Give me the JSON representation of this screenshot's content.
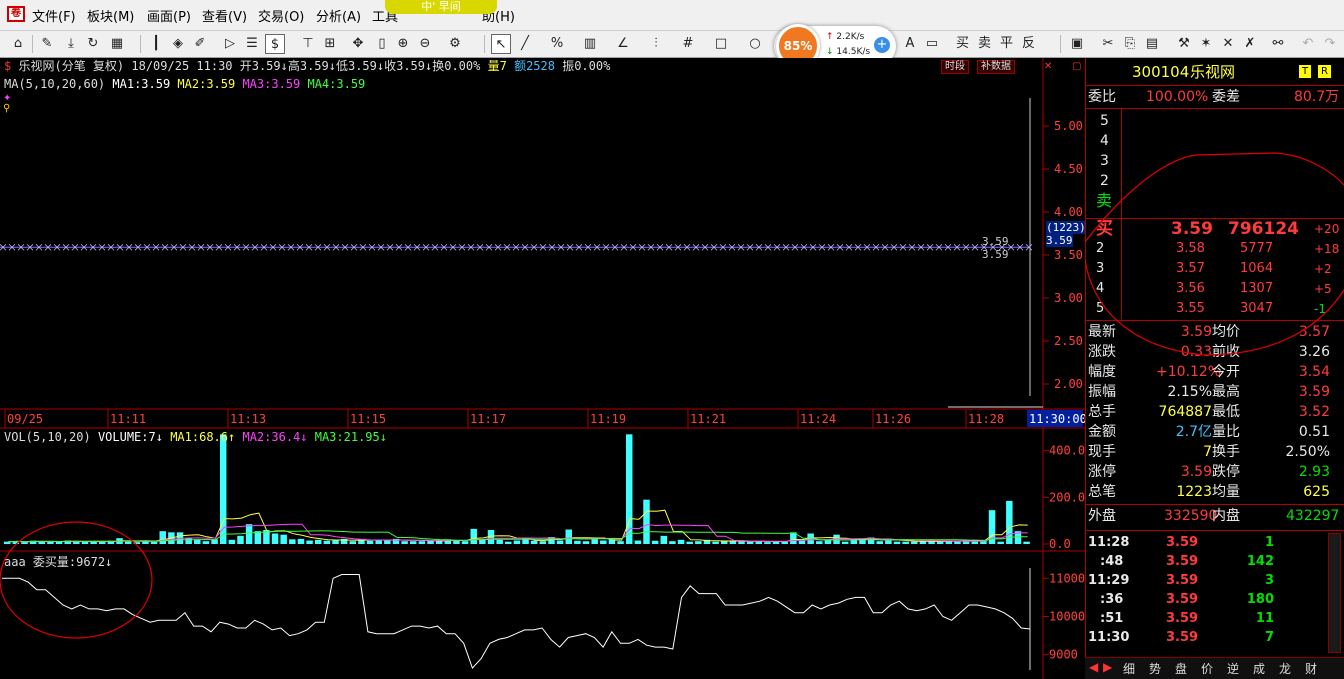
{
  "menu": {
    "items": [
      "文件(F)",
      "板块(M)",
      "画面(P)",
      "查看(V)",
      "交易(O)",
      "分析(A)",
      "工具",
      "助(H)"
    ],
    "balloon": "中' 早间"
  },
  "speed": {
    "percent": "85%",
    "up": "2.2K/s",
    "down": "14.5K/s"
  },
  "toolbar": {
    "tx": [
      "买",
      "卖",
      "平",
      "反"
    ]
  },
  "chart": {
    "header": "乐视网(分笔 复权) 18/09/25 11:30 开3.59↓高3.59↓低3.59↓收3.59↓换0.00%",
    "header_vol": "量7",
    "header_amt": "额2528",
    "header_amp": "振0.00%",
    "ma_label": "MA(5,10,20,60)",
    "ma1": "MA1:3.59",
    "ma2": "MA2:3.59",
    "ma3": "MA3:3.59",
    "ma4": "MA4:3.59",
    "btn_time": "时段",
    "btn_fill": "补数据",
    "price_labels": [
      "5.00",
      "4.50",
      "4.00",
      "3.50",
      "3.00",
      "2.50",
      "2.00"
    ],
    "price_tag_1": "(1223)",
    "price_tag_2": "3.59",
    "price_line_lbl": "3.59",
    "time_labels": [
      "09/25",
      "11:11",
      "11:13",
      "11:15",
      "11:17",
      "11:19",
      "11:21",
      "11:24",
      "11:26",
      "11:28"
    ],
    "time_current": "11:30:00",
    "vol_label": "VOL(5,10,20)",
    "vol_value": "VOLUME:7↓",
    "vol_ma1": "MA1:68.6↑",
    "vol_ma2": "MA2:36.4↓",
    "vol_ma3": "MA3:21.95↓",
    "vol_axis": [
      "400.0",
      "200.0",
      "0.0"
    ],
    "ind_label": "aaa",
    "ind_value": "委买量:9672↓",
    "ind_axis": [
      "11000",
      "10000",
      "9000"
    ]
  },
  "chart_data": [
    {
      "type": "bar",
      "title": "VOL(5,10,20)",
      "ylim": [
        0,
        480
      ],
      "values": [
        10,
        12,
        8,
        14,
        12,
        10,
        9,
        15,
        11,
        10,
        12,
        9,
        14,
        25,
        10,
        8,
        12,
        10,
        55,
        50,
        50,
        25,
        18,
        12,
        20,
        470,
        18,
        35,
        85,
        55,
        60,
        45,
        40,
        20,
        22,
        15,
        18,
        14,
        16,
        22,
        12,
        20,
        14,
        18,
        16,
        22,
        12,
        12,
        12,
        14,
        14,
        20,
        14,
        12,
        65,
        20,
        60,
        18,
        10,
        15,
        25,
        14,
        12,
        30,
        15,
        62,
        14,
        12,
        25,
        15,
        20,
        12,
        470,
        15,
        190,
        14,
        35,
        12,
        18,
        10,
        12,
        18,
        10,
        14,
        12,
        10,
        10,
        14,
        8,
        12,
        10,
        50,
        14,
        45,
        12,
        18,
        40,
        10,
        18,
        20,
        28,
        12,
        15,
        10,
        10,
        10,
        12,
        14,
        10,
        12,
        12,
        18,
        12,
        15,
        145,
        10,
        185,
        55,
        10
      ]
    },
    {
      "type": "line",
      "title": "委买量",
      "ylim": [
        8600,
        11400
      ],
      "values": [
        11000,
        11000,
        11000,
        10900,
        10700,
        10700,
        10500,
        10300,
        10200,
        10300,
        10200,
        10200,
        10150,
        10200,
        10200,
        10050,
        9950,
        9850,
        9900,
        9900,
        9900,
        10100,
        9750,
        9750,
        9600,
        9850,
        9800,
        9700,
        9700,
        9900,
        9800,
        9650,
        9700,
        9500,
        9550,
        9650,
        9850,
        9850,
        11000,
        11100,
        11100,
        11100,
        9600,
        9550,
        9550,
        9550,
        9650,
        9750,
        9750,
        9700,
        9750,
        9550,
        9550,
        9300,
        8650,
        8900,
        9300,
        9400,
        9450,
        9550,
        9650,
        9650,
        9700,
        9400,
        9200,
        9450,
        9500,
        9550,
        9450,
        9200,
        9600,
        9300,
        9300,
        9400,
        9250,
        9200,
        9200,
        9150,
        10500,
        10800,
        10600,
        10600,
        10600,
        10300,
        10300,
        10300,
        10350,
        10400,
        10500,
        10400,
        10250,
        10100,
        10100,
        10300,
        10200,
        10300,
        10350,
        10450,
        10500,
        10500,
        10100,
        10100,
        10300,
        10400,
        10200,
        10150,
        10200,
        10300,
        10000,
        9900,
        10100,
        10300,
        10300,
        10250,
        10200,
        10100,
        9950,
        9700,
        9672
      ]
    }
  ],
  "quote": {
    "code": "300104",
    "name": "乐视网",
    "tag_t": "T",
    "tag_r": "R",
    "weibi_lbl": "委比",
    "weibi": "100.00%",
    "weicha_lbl": "委差",
    "weicha": "80.7万",
    "sell_levels": [
      "5",
      "4",
      "3",
      "2"
    ],
    "sell_lbl": "卖",
    "buy_lbl": "买",
    "buy": [
      {
        "lv": "",
        "price": "3.59",
        "vol": "796124",
        "chg": "+20"
      },
      {
        "lv": "2",
        "price": "3.58",
        "vol": "5777",
        "chg": "+18"
      },
      {
        "lv": "3",
        "price": "3.57",
        "vol": "1064",
        "chg": "+2"
      },
      {
        "lv": "4",
        "price": "3.56",
        "vol": "1307",
        "chg": "+5"
      },
      {
        "lv": "5",
        "price": "3.55",
        "vol": "3047",
        "chg": "-1"
      }
    ],
    "stats": [
      {
        "k1": "最新",
        "v1": "3.59",
        "k2": "均价",
        "v2": "3.57"
      },
      {
        "k1": "涨跌",
        "v1": "0.33",
        "k2": "前收",
        "v2": "3.26"
      },
      {
        "k1": "幅度",
        "v1": "+10.12%",
        "k2": "今开",
        "v2": "3.54"
      },
      {
        "k1": "振幅",
        "v1": "2.15%",
        "k2": "最高",
        "v2": "3.59"
      },
      {
        "k1": "总手",
        "v1": "764887",
        "k2": "最低",
        "v2": "3.52"
      },
      {
        "k1": "金额",
        "v1": "2.7亿",
        "k2": "量比",
        "v2": "0.51"
      },
      {
        "k1": "现手",
        "v1": "7",
        "k2": "换手",
        "v2": "2.50%"
      },
      {
        "k1": "涨停",
        "v1": "3.59",
        "k2": "跌停",
        "v2": "2.93"
      },
      {
        "k1": "总笔",
        "v1": "1223",
        "k2": "均量",
        "v2": "625"
      }
    ],
    "outer_lbl": "外盘",
    "outer": "332590",
    "inner_lbl": "内盘",
    "inner": "432297",
    "ticks": [
      {
        "t": "11:28",
        "p": "3.59",
        "v": "1"
      },
      {
        "t": ":48",
        "p": "3.59",
        "v": "142"
      },
      {
        "t": "11:29",
        "p": "3.59",
        "v": "3"
      },
      {
        "t": ":36",
        "p": "3.59",
        "v": "180"
      },
      {
        "t": ":51",
        "p": "3.59",
        "v": "11"
      },
      {
        "t": "11:30",
        "p": "3.59",
        "v": "7"
      }
    ],
    "tabs": [
      "细",
      "势",
      "盘",
      "价",
      "逆",
      "成",
      "龙",
      "财"
    ]
  },
  "colors": {
    "up": "#ff3b3b",
    "down": "#00e000",
    "grid": "#b00000",
    "vol": "#40ffff"
  }
}
